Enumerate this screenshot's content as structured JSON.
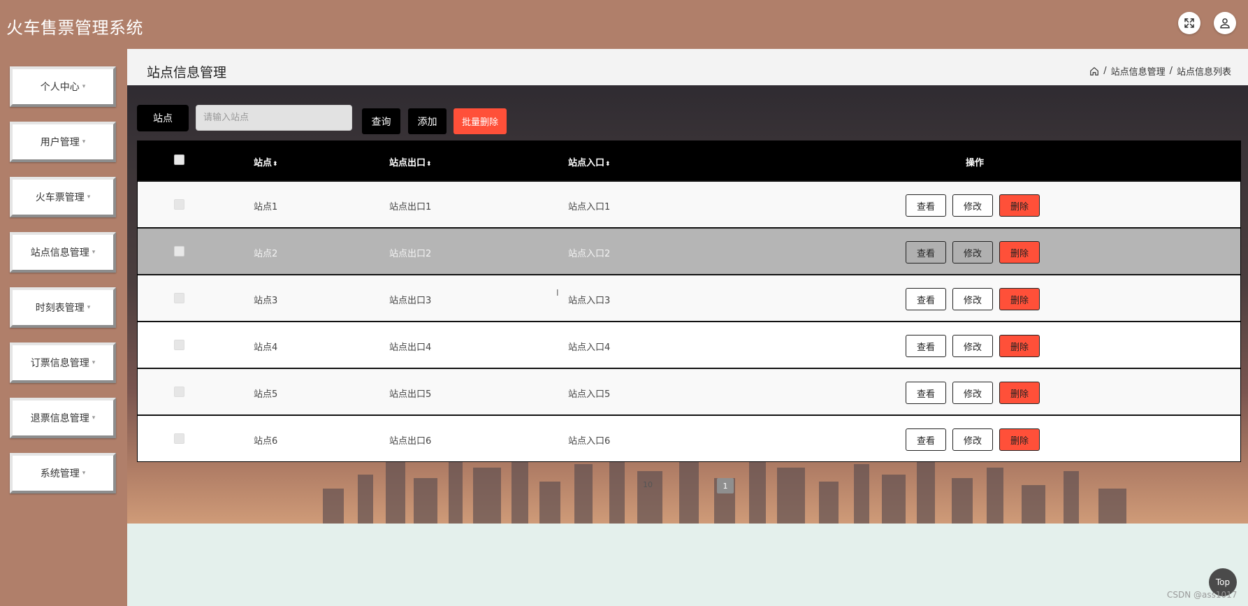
{
  "app": {
    "title": "火车售票管理系统"
  },
  "header": {
    "fullscreen_icon": "expand-icon",
    "user_icon": "user-icon"
  },
  "sidebar": {
    "items": [
      {
        "label": "个人中心"
      },
      {
        "label": "用户管理"
      },
      {
        "label": "火车票管理"
      },
      {
        "label": "站点信息管理"
      },
      {
        "label": "时刻表管理"
      },
      {
        "label": "订票信息管理"
      },
      {
        "label": "退票信息管理"
      },
      {
        "label": "系统管理"
      }
    ],
    "caret": "▾"
  },
  "page": {
    "title": "站点信息管理",
    "breadcrumb": {
      "sep": "/",
      "level1": "站点信息管理",
      "level2": "站点信息列表"
    }
  },
  "search": {
    "label": "站点",
    "placeholder": "请输入站点",
    "value": "",
    "query_label": "查询",
    "add_label": "添加",
    "batch_delete_label": "批量删除"
  },
  "table": {
    "columns": {
      "station": "站点",
      "exit": "站点出口",
      "entrance": "站点入口",
      "actions": "操作",
      "sort_icon": "⬍"
    },
    "rows": [
      {
        "station": "站点1",
        "exit": "站点出口1",
        "entrance": "站点入口1"
      },
      {
        "station": "站点2",
        "exit": "站点出口2",
        "entrance": "站点入口2"
      },
      {
        "station": "站点3",
        "exit": "站点出口3",
        "entrance": "站点入口3"
      },
      {
        "station": "站点4",
        "exit": "站点出口4",
        "entrance": "站点入口4"
      },
      {
        "station": "站点5",
        "exit": "站点出口5",
        "entrance": "站点入口5"
      },
      {
        "station": "站点6",
        "exit": "站点出口6",
        "entrance": "站点入口6"
      }
    ],
    "actions": {
      "view": "查看",
      "edit": "修改",
      "delete": "删除"
    }
  },
  "pagination": {
    "page_size": "10",
    "current_page": "1"
  },
  "footer": {
    "top_label": "Top",
    "watermark": "CSDN @ass1017"
  },
  "colors": {
    "header_bg": "#b07f6a",
    "danger": "#ff5039",
    "primary": "#000000"
  }
}
